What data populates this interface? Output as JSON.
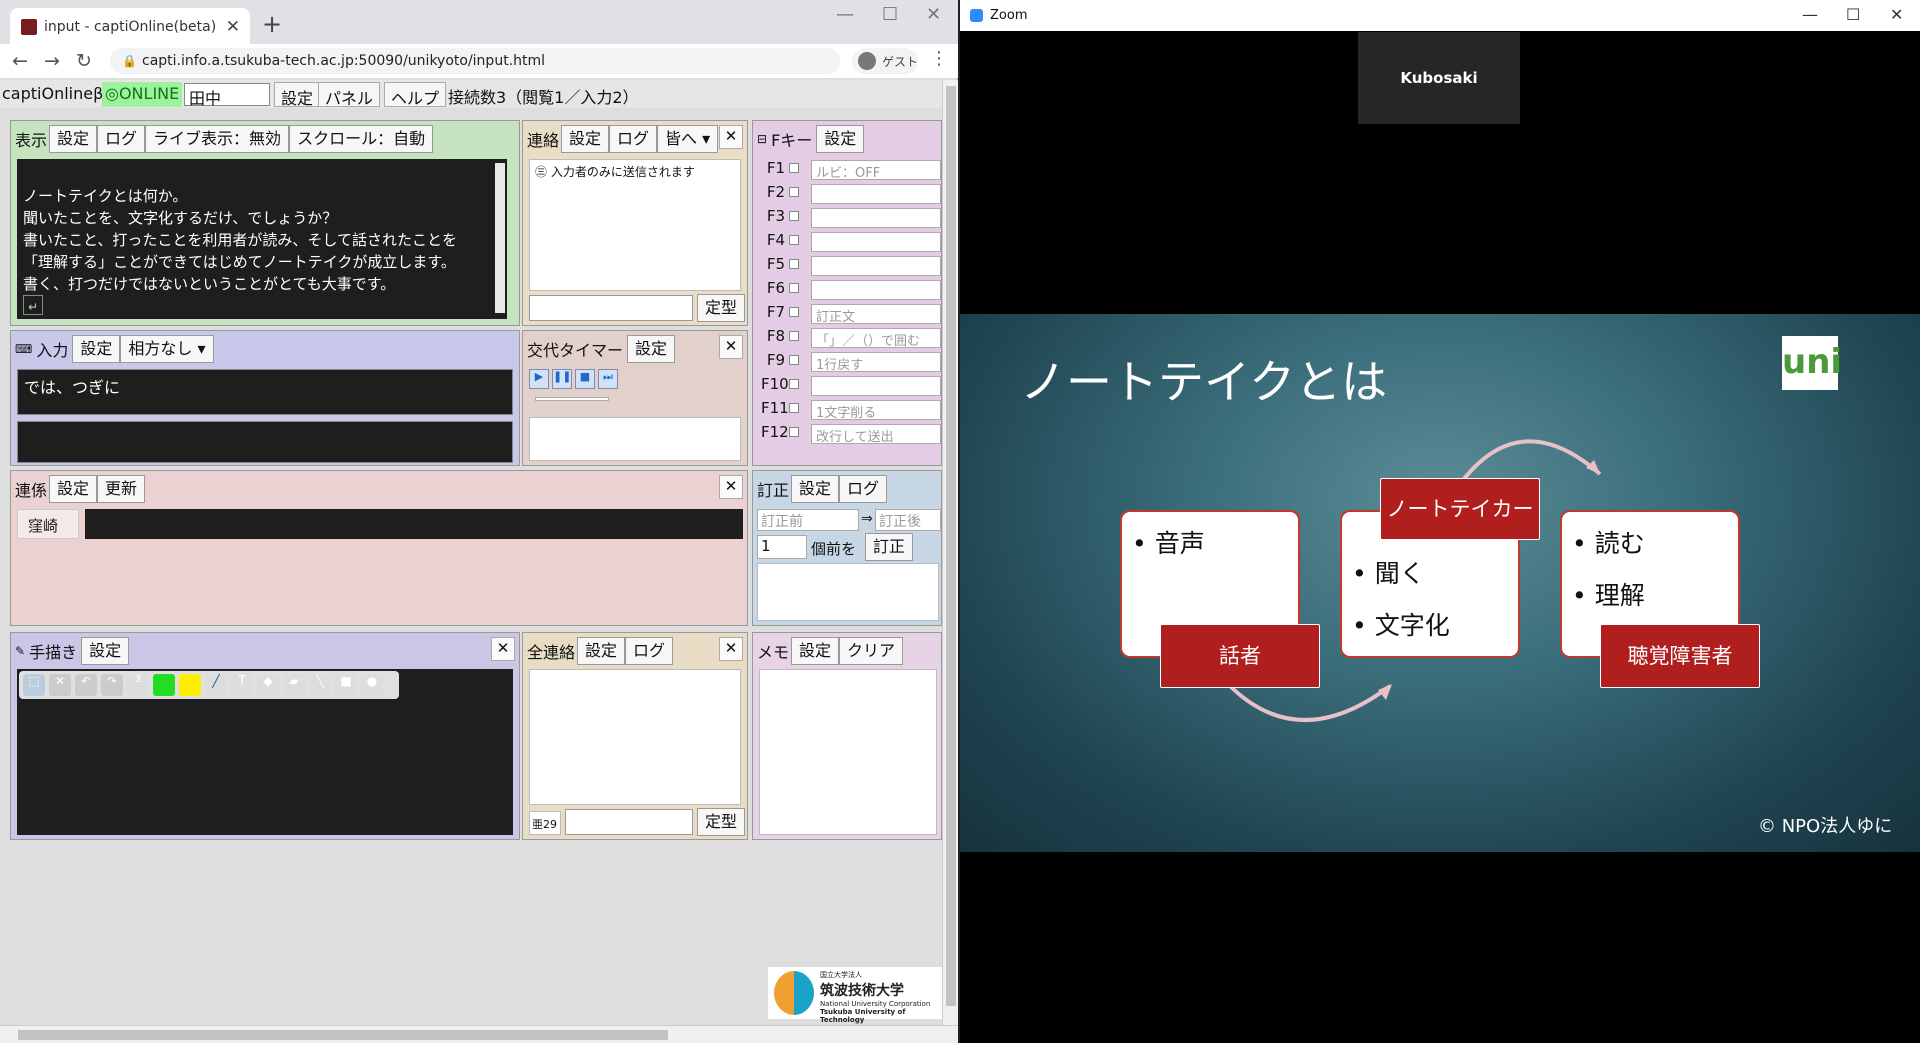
{
  "browser": {
    "tab_title": "input - captiOnline(beta)",
    "url": "capti.info.a.tsukuba-tech.ac.jp:50090/unikyoto/input.html",
    "guest_label": "ゲスト"
  },
  "toolbar": {
    "app_name": "captiOnlineβ",
    "status": "◎ONLINE",
    "user_name": "田中",
    "settings": "設定",
    "panel": "パネル",
    "help": "ヘルプ",
    "connections": "接続数3（閲覧1／入力2）"
  },
  "display_panel": {
    "title": "表示",
    "settings": "設定",
    "log": "ログ",
    "live": "ライブ表示：無効",
    "scroll": "スクロール：自動",
    "lines": [
      "ノートテイクとは何か。",
      "聞いたことを、文字化するだけ、でしょうか？",
      "書いたこと、打ったことを利用者が読み、そして話されたことを",
      "「理解する」ことができてはじめてノートテイクが成立します。",
      "書く、打つだけではないということがとても大事です。"
    ]
  },
  "contact_panel": {
    "title": "連絡",
    "settings": "設定",
    "log": "ログ",
    "target": "皆へ",
    "note": "㊂ 入力者のみに送信されます",
    "template": "定型"
  },
  "fkey_panel": {
    "title": "Fキー",
    "settings": "設定",
    "keys": [
      {
        "key": "F1",
        "value": "ルビ：OFF"
      },
      {
        "key": "F2",
        "value": ""
      },
      {
        "key": "F3",
        "value": ""
      },
      {
        "key": "F4",
        "value": ""
      },
      {
        "key": "F5",
        "value": ""
      },
      {
        "key": "F6",
        "value": ""
      },
      {
        "key": "F7",
        "value": "訂正文"
      },
      {
        "key": "F8",
        "value": "「」／（）で囲む"
      },
      {
        "key": "F9",
        "value": "1行戻す"
      },
      {
        "key": "F10",
        "value": ""
      },
      {
        "key": "F11",
        "value": "1文字削る"
      },
      {
        "key": "F12",
        "value": "改行して送出"
      }
    ]
  },
  "input_panel": {
    "title": "入力",
    "settings": "設定",
    "partner": "相方なし",
    "text": "では、つぎに"
  },
  "timer_panel": {
    "title": "交代タイマー",
    "settings": "設定"
  },
  "relay_panel": {
    "title": "連係",
    "settings": "設定",
    "update": "更新",
    "name": "窪崎"
  },
  "correction_panel": {
    "title": "訂正",
    "settings": "設定",
    "log": "ログ",
    "before": "訂正前",
    "after": "訂正後",
    "arrow": "⇒",
    "count": "1",
    "count_label": "個前を",
    "apply": "訂正"
  },
  "draw_panel": {
    "title": "手描き",
    "settings": "設定"
  },
  "all_contact_panel": {
    "title": "全連絡",
    "settings": "設定",
    "log": "ログ",
    "counter": "亜29",
    "template": "定型"
  },
  "memo_panel": {
    "title": "メモ",
    "settings": "設定",
    "clear": "クリア"
  },
  "zoom": {
    "window_title": "Zoom",
    "participant": "Kubosaki",
    "slide": {
      "title": "ノートテイクとは",
      "logo": "uni",
      "box1_item": "音声",
      "box1_tag": "話者",
      "box2_tag": "ノートテイカー",
      "box2_items": [
        "聞く",
        "文字化"
      ],
      "box3_items": [
        "読む",
        "理解"
      ],
      "box3_tag": "聴覚障害者",
      "copyright": "© NPO法人ゆに"
    }
  },
  "university": {
    "line1": "国立大学法人",
    "name": "筑波技術大学",
    "line2": "National University Corporation",
    "line3": "Tsukuba University of Technology"
  }
}
